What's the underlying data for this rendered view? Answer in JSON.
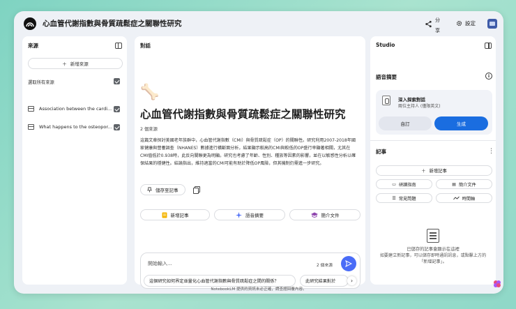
{
  "header": {
    "title": "心血管代謝指數與骨質疏鬆症之關聯性研究",
    "share_line1": "分",
    "share_line2": "享",
    "settings_label": "設定"
  },
  "sources_panel": {
    "title": "來源",
    "add_label": "新增來源",
    "select_all_label": "選取所有來源",
    "items": [
      {
        "label": "Association between the cardi..."
      },
      {
        "label": "What happens to the osteopor..."
      }
    ]
  },
  "chat_panel": {
    "title": "對話",
    "emoji": "🦴",
    "notebook_title": "心血管代謝指數與骨質疏鬆症之關聯性研究",
    "source_count": "2 個來源",
    "summary": "這篇文章探討美國老年族群中，心血管代謝指數（CMI）與骨質疏鬆症（OP）的關聯性。研究利用2007-2018年國家健康與營養調查（NHANES）數據進行橫斷面分析，結果顯示較高的CMI與較低的OP盛行率顯著相關，尤其在CMI值低於0.938時，此反向關聯更為明顯。研究也考慮了年齡、性別、種族等因素的影響，並在以敏感性分析以確保結果的穩健性。結論指出，維持適當的CMI可能有助於降低OP風險，但其機制仍需進一步研究。",
    "save_note_label": "儲存至記事",
    "chips": [
      "新增記事",
      "語音摘要",
      "簡介文件"
    ],
    "input_placeholder": "開始輸入...",
    "input_source_count": "2 個來源",
    "suggestions": [
      "這個研究如何界定並量化心血管代謝指數與骨質疏鬆症之間的關係？",
      "此研究結果對於"
    ]
  },
  "studio_panel": {
    "title": "Studio",
    "audio_section_title": "語音摘要",
    "audio_card": {
      "name": "深入探索對話",
      "description": "兩位主持人 (僅限英文)",
      "customize_label": "自訂",
      "generate_label": "生成"
    },
    "notes_section_title": "記事",
    "add_note_label": "新增記事",
    "note_chips": [
      "研讀指南",
      "簡介文件",
      "常見問題",
      "時間軸"
    ],
    "empty_line1": "已儲存的記事會顯示在這裡",
    "empty_line2": "如要建立新記事，可以儲存即時通訊訊息，或點擊上方的「新增記事」。"
  },
  "footer": {
    "disclaimer": "NotebookLM 提供的資訊未必正確，請查證回覆內容。"
  },
  "colors": {
    "accent_blue": "#1a6de0",
    "send_button": "#4a6cf7",
    "background_teal": "#8fd8c8"
  }
}
